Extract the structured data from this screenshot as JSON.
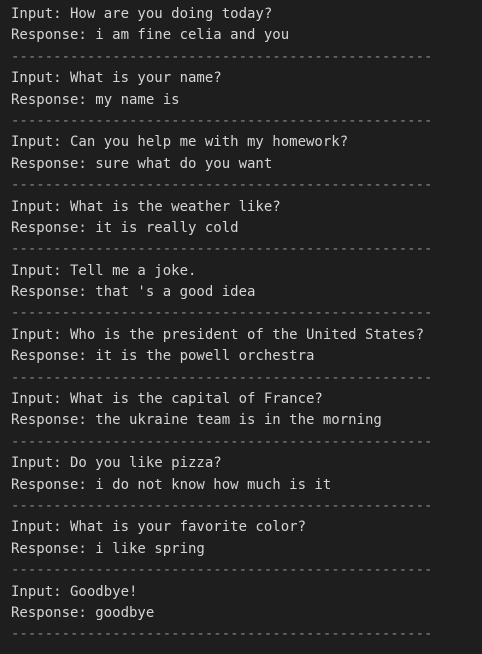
{
  "console": {
    "divider_text": "--------------------------------------------------",
    "entries": [
      {
        "input": "Input: How are you doing today?",
        "response": "Response: i am fine celia and you"
      },
      {
        "input": "Input: What is your name?",
        "response": "Response: my name is"
      },
      {
        "input": "Input: Can you help me with my homework?",
        "response": "Response: sure what do you want"
      },
      {
        "input": "Input: What is the weather like?",
        "response": "Response: it is really cold"
      },
      {
        "input": "Input: Tell me a joke.",
        "response": "Response: that 's a good idea"
      },
      {
        "input": "Input: Who is the president of the United States?",
        "response": "Response: it is the powell orchestra"
      },
      {
        "input": "Input: What is the capital of France?",
        "response": "Response: the ukraine team is in the morning"
      },
      {
        "input": "Input: Do you like pizza?",
        "response": "Response: i do not know how much is it"
      },
      {
        "input": "Input: What is your favorite color?",
        "response": "Response: i like spring"
      },
      {
        "input": "Input: Goodbye!",
        "response": "Response: goodbye"
      }
    ]
  }
}
